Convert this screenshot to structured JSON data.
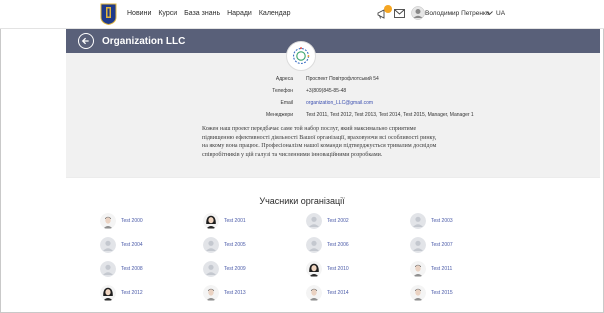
{
  "nav": {
    "items": [
      "Новини",
      "Курси",
      "База знань",
      "Наради",
      "Календар"
    ],
    "user_name": "Володимир Петренко",
    "language": "UA",
    "notification_count": ""
  },
  "header": {
    "title": "Organization LLC"
  },
  "info": {
    "fields": [
      {
        "label": "Адреса",
        "value": "Проспект Повітрофлотський 54"
      },
      {
        "label": "Телефон",
        "value": "+3(809)845-85-48"
      },
      {
        "label": "Email",
        "value": "organization_LLC@gmail.com"
      },
      {
        "label": "Менеджери",
        "value": "Test 2011, Test 2012, Test 2013, Test 2014, Test 2015, Manager, Manager 1"
      }
    ],
    "description": "Кожен наш проект передбачає саме той набор послуг, який максимально сприятиме підвищенню ефективності діяльності Вашої організації, враховуючи всі особливості ринку, на якому вона працює. Професіоналізм нашої команди підтверджується тривалим досвідом співробітників у цій галузі та численними інноваційними розробками."
  },
  "members": {
    "title": "Учасники організації",
    "list": [
      {
        "name": "Test 2000",
        "avatar": "male-photo"
      },
      {
        "name": "Test 2001",
        "avatar": "female-photo"
      },
      {
        "name": "Test 2002",
        "avatar": "placeholder"
      },
      {
        "name": "Test 2003",
        "avatar": "placeholder"
      },
      {
        "name": "Test 2004",
        "avatar": "placeholder"
      },
      {
        "name": "Test 2005",
        "avatar": "placeholder"
      },
      {
        "name": "Test 2006",
        "avatar": "placeholder"
      },
      {
        "name": "Test 2007",
        "avatar": "placeholder"
      },
      {
        "name": "Test 2008",
        "avatar": "placeholder"
      },
      {
        "name": "Test 2009",
        "avatar": "placeholder"
      },
      {
        "name": "Test 2010",
        "avatar": "female-photo"
      },
      {
        "name": "Test 2011",
        "avatar": "male-photo"
      },
      {
        "name": "Test 2012",
        "avatar": "female-photo"
      },
      {
        "name": "Test 2013",
        "avatar": "male-photo"
      },
      {
        "name": "Test 2014",
        "avatar": "male-photo"
      },
      {
        "name": "Test 2015",
        "avatar": "male-photo"
      }
    ]
  },
  "colors": {
    "header_band": "#596079",
    "link": "#4a5aa8",
    "panel": "#f1f1f1",
    "badge": "#f5a623"
  }
}
